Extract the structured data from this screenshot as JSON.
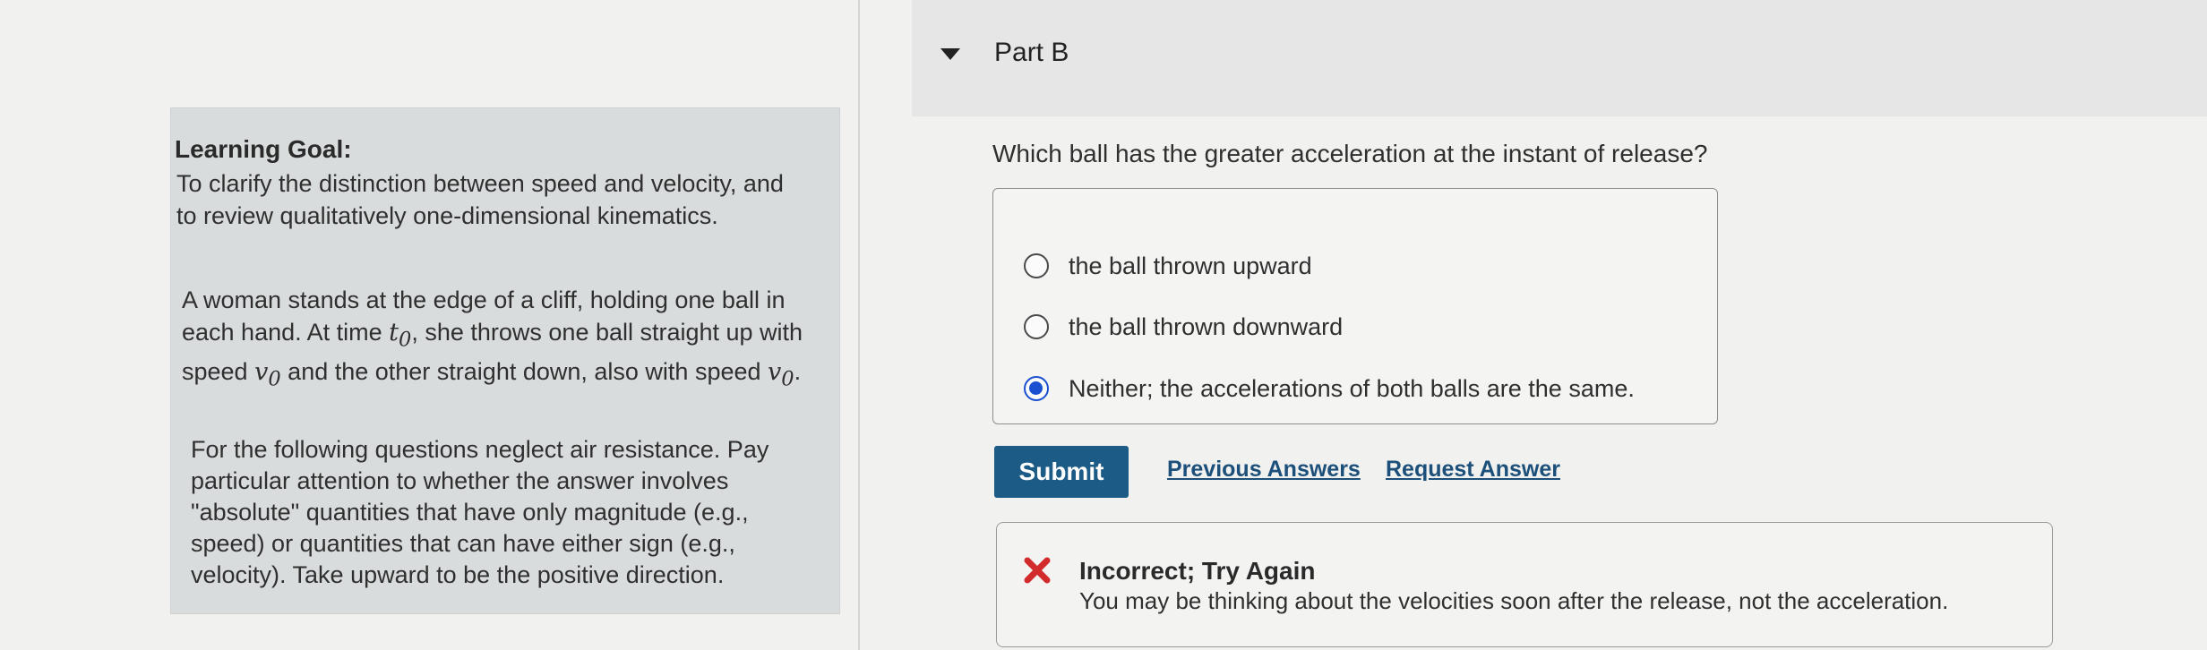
{
  "goal": {
    "title": "Learning Goal:",
    "text": "To clarify the distinction between speed and velocity, and to review qualitatively one-dimensional kinematics.",
    "para1_a": "A woman stands at the edge of a cliff, holding one ball in each hand. At time ",
    "t0": "t0",
    "para1_b": ", she throws one ball straight up with speed ",
    "v0": "v0",
    "para1_c": " and the other straight down, also with speed ",
    "para1_d": ".",
    "para2": "For the following questions neglect air resistance. Pay particular attention to whether the answer involves \"absolute\" quantities that have only magnitude (e.g., speed) or quantities that can have either sign (e.g., velocity). Take upward to be the positive direction."
  },
  "part": {
    "label": "Part B",
    "question": "Which ball has the greater acceleration at the instant of release?",
    "options": [
      {
        "label": "the ball thrown upward",
        "selected": false
      },
      {
        "label": "the ball thrown downward",
        "selected": false
      },
      {
        "label": "Neither; the accelerations of both balls are the same.",
        "selected": true
      }
    ]
  },
  "actions": {
    "submit": "Submit",
    "previous_answers": "Previous Answers",
    "request_answer": "Request Answer"
  },
  "feedback": {
    "title": "Incorrect; Try Again",
    "text": "You may be thinking about the velocities soon after the release, not the acceleration."
  },
  "colors": {
    "submit_bg": "#1c5b85",
    "link": "#1c4f7a",
    "radio_selected": "#1a4fd0",
    "error_x": "#d22b2b"
  }
}
